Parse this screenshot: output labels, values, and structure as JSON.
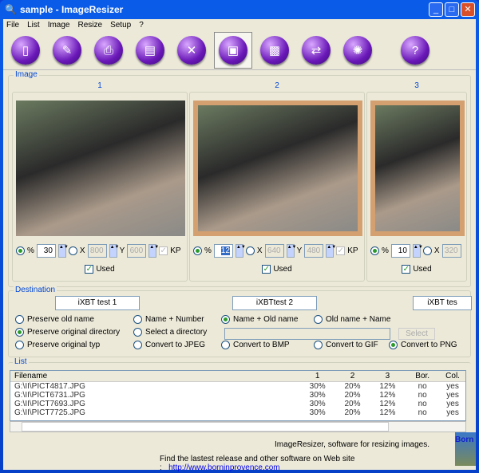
{
  "window": {
    "title": "sample - ImageResizer"
  },
  "menu": [
    "File",
    "List",
    "Image",
    "Resize",
    "Setup",
    "?"
  ],
  "toolbar": [
    {
      "icon": "page-icon",
      "g": "▯"
    },
    {
      "icon": "notebook-icon",
      "g": "✎"
    },
    {
      "icon": "printer-icon",
      "g": "⎙"
    },
    {
      "icon": "film-icon",
      "g": "▤"
    },
    {
      "icon": "delete-image-icon",
      "g": "✕"
    },
    {
      "icon": "image-icon",
      "g": "▣"
    },
    {
      "icon": "photo-icon",
      "g": "▩"
    },
    {
      "icon": "convert-icon",
      "g": "⇄"
    },
    {
      "icon": "film-reel-icon",
      "g": "✺"
    },
    {
      "icon": "help-icon",
      "g": "?"
    }
  ],
  "image": {
    "label": "Image",
    "panels": [
      {
        "num": "1",
        "percent": "30",
        "x": "800",
        "y": "600",
        "kp": "KP",
        "used": "Used"
      },
      {
        "num": "2",
        "percent": "12",
        "x": "640",
        "y": "480",
        "kp": "KP",
        "used": "Used"
      },
      {
        "num": "3",
        "percent": "10",
        "x": "320",
        "used": "Used"
      }
    ]
  },
  "destination": {
    "label": "Destination",
    "names": [
      "iXBT test 1",
      "iXBTtest 2",
      "iXBT tes"
    ],
    "options": [
      "Preserve old name",
      "Name + Number",
      "Name + Old name",
      "Old name + Name",
      "Preserve original directory",
      "Select a directory",
      "Preserve original typ",
      "Convert to JPEG",
      "Convert to BMP",
      "Convert to GIF",
      "Convert to PNG"
    ],
    "select": "Select",
    "path": ""
  },
  "list": {
    "label": "List",
    "headers": [
      "Filename",
      "1",
      "2",
      "3",
      "Bor.",
      "Col."
    ],
    "rows": [
      [
        "G:\\II\\PICT4817.JPG",
        "30%",
        "20%",
        "12%",
        "no",
        "yes"
      ],
      [
        "G:\\II\\PICT6731.JPG",
        "30%",
        "20%",
        "12%",
        "no",
        "yes"
      ],
      [
        "G:\\II\\PICT7693.JPG",
        "30%",
        "20%",
        "12%",
        "no",
        "yes"
      ],
      [
        "G:\\II\\PICT7725.JPG",
        "30%",
        "20%",
        "12%",
        "no",
        "yes"
      ]
    ]
  },
  "footer": {
    "tagline": "ImageResizer, software for resizing images.",
    "find": "Find the lastest release and other software on Web site :",
    "url": "http://www.borninprovence.com",
    "logo": "Born"
  }
}
